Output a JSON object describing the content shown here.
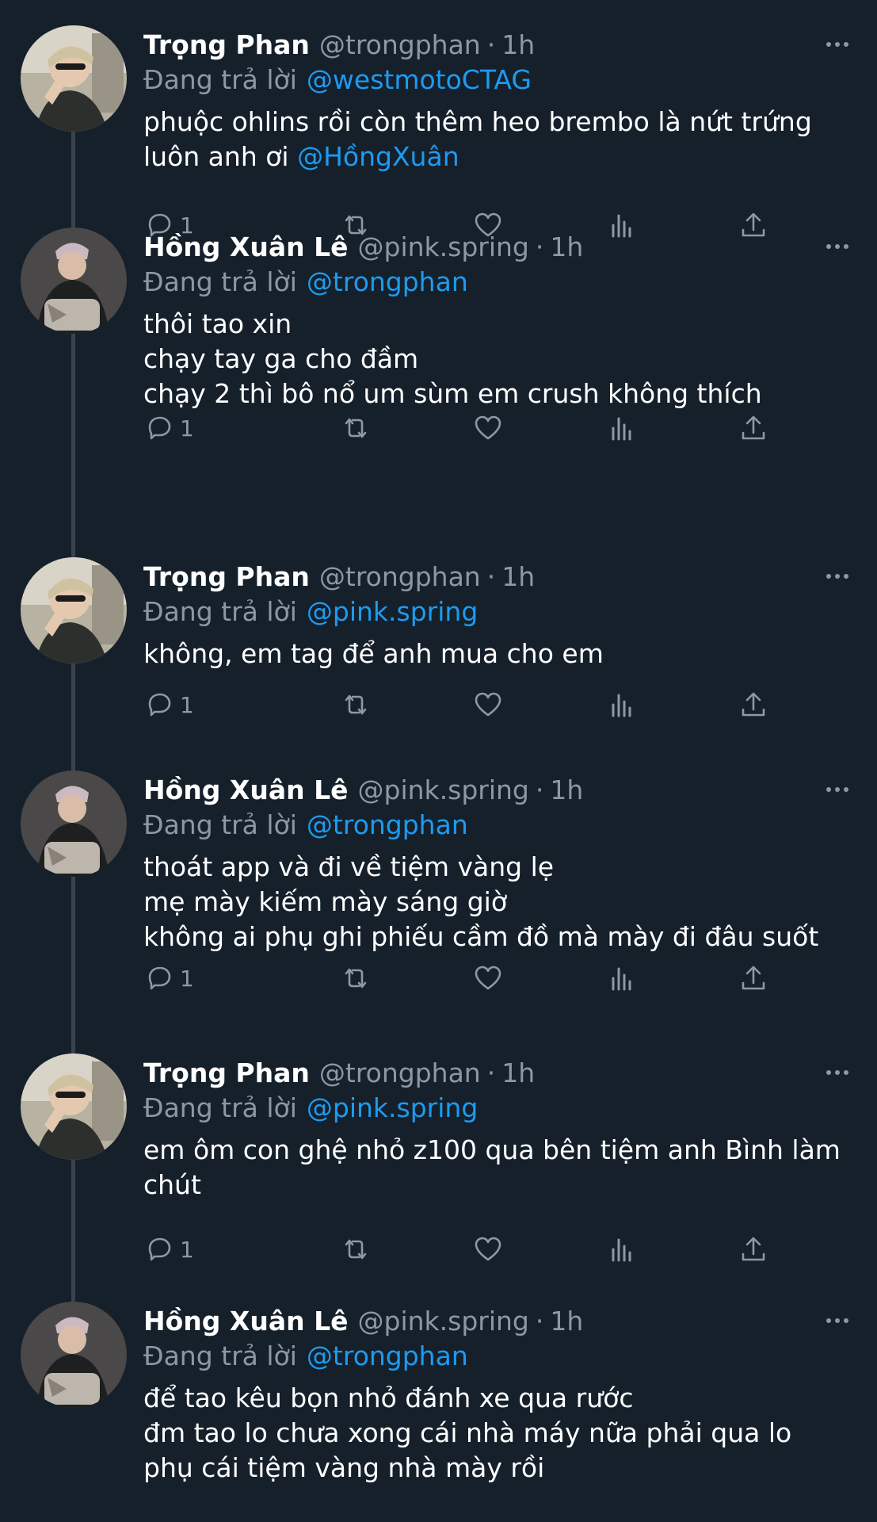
{
  "labels": {
    "replying_to": "Đang trả lời"
  },
  "colors": {
    "background": "#15202b",
    "link": "#1d9bf0",
    "muted": "#8b98a5"
  },
  "tweets": [
    {
      "name": "Trọng Phan",
      "handle": "@trongphan",
      "time": "1h",
      "reply_to": "@westmotoCTAG",
      "lines": [
        "phuộc ohlins rồi còn thêm heo brembo là nứt trứng",
        "luôn anh ơi "
      ],
      "inline_mention": "@HồngXuân",
      "reply_count": "1",
      "avatar": "avatar-trongphan-icon"
    },
    {
      "name": "Hồng Xuân Lê",
      "handle": "@pink.spring",
      "time": "1h",
      "reply_to": "@trongphan",
      "lines": [
        "thôi tao xin",
        "chạy tay ga cho đầm",
        "chạy 2 thì bô nổ um sùm em crush không thích"
      ],
      "reply_count": "1",
      "avatar": "avatar-pinkspring-icon"
    },
    {
      "name": "Trọng Phan",
      "handle": "@trongphan",
      "time": "1h",
      "reply_to": "@pink.spring",
      "lines": [
        "không, em tag để anh mua cho em"
      ],
      "reply_count": "1",
      "avatar": "avatar-trongphan-icon"
    },
    {
      "name": "Hồng Xuân Lê",
      "handle": "@pink.spring",
      "time": "1h",
      "reply_to": "@trongphan",
      "lines": [
        "thoát app và đi về tiệm vàng lẹ",
        "mẹ mày kiếm mày sáng giờ",
        "không ai phụ ghi phiếu cầm đồ mà mày đi đâu suốt"
      ],
      "reply_count": "1",
      "avatar": "avatar-pinkspring-icon"
    },
    {
      "name": "Trọng Phan",
      "handle": "@trongphan",
      "time": "1h",
      "reply_to": "@pink.spring",
      "lines": [
        "em ôm con ghệ nhỏ z100 qua bên tiệm anh Bình làm",
        "chút"
      ],
      "reply_count": "1",
      "avatar": "avatar-trongphan-icon"
    },
    {
      "name": "Hồng Xuân Lê",
      "handle": "@pink.spring",
      "time": "1h",
      "reply_to": "@trongphan",
      "lines": [
        "để tao kêu bọn nhỏ đánh xe qua rước",
        "đm tao lo chưa xong cái nhà máy nữa phải qua lo",
        "phụ cái tiệm vàng nhà mày rồi"
      ],
      "avatar": "avatar-pinkspring-icon"
    }
  ]
}
